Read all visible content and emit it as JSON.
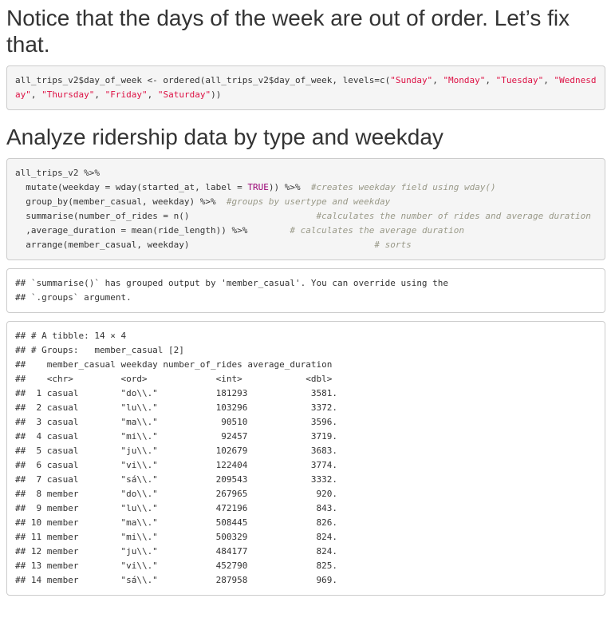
{
  "heading1": "Notice that the days of the week are out of order. Let’s fix that.",
  "code1": {
    "prefix": "all_trips_v2$day_of_week <- ordered(all_trips_v2$day_of_week, levels=c(",
    "levels": [
      "\"Sunday\"",
      "\"Monday\"",
      "\"Tuesday\"",
      "\"Wednesday\"",
      "\"Thursday\"",
      "\"Friday\"",
      "\"Saturday\""
    ],
    "suffix": "))"
  },
  "heading2": "Analyze ridership data by type and weekday",
  "code2": {
    "line1": "all_trips_v2 %>%",
    "line2_code_a": "  mutate(weekday = wday(started_at, label = ",
    "line2_true": "TRUE",
    "line2_code_b": ")) %>%  ",
    "line2_comment": "#creates weekday field using wday()",
    "line3_code": "  group_by(member_casual, weekday) %>%  ",
    "line3_comment": "#groups by usertype and weekday",
    "line4_code": "  summarise(number_of_rides = n()                        ",
    "line4_comment": "#calculates the number of rides and average duration",
    "line5_code": "  ,average_duration = mean(ride_length)) %>%        ",
    "line5_comment": "# calculates the average duration",
    "line6_code": "  arrange(member_casual, weekday)                                   ",
    "line6_comment": "# sorts"
  },
  "message": {
    "line1": "## `summarise()` has grouped output by 'member_casual'. You can override using the",
    "line2": "## `.groups` argument."
  },
  "tibble": {
    "header_lines": [
      "## # A tibble: 14 × 4",
      "## # Groups:   member_casual [2]",
      "##    member_casual weekday number_of_rides average_duration",
      "##    <chr>         <ord>             <int>            <dbl>"
    ],
    "rows": [
      "##  1 casual        \"do\\\\.\"           181293            3581.",
      "##  2 casual        \"lu\\\\.\"           103296            3372.",
      "##  3 casual        \"ma\\\\.\"            90510            3596.",
      "##  4 casual        \"mi\\\\.\"            92457            3719.",
      "##  5 casual        \"ju\\\\.\"           102679            3683.",
      "##  6 casual        \"vi\\\\.\"           122404            3774.",
      "##  7 casual        \"sá\\\\.\"           209543            3332.",
      "##  8 member        \"do\\\\.\"           267965             920.",
      "##  9 member        \"lu\\\\.\"           472196             843.",
      "## 10 member        \"ma\\\\.\"           508445             826.",
      "## 11 member        \"mi\\\\.\"           500329             824.",
      "## 12 member        \"ju\\\\.\"           484177             824.",
      "## 13 member        \"vi\\\\.\"           452790             825.",
      "## 14 member        \"sá\\\\.\"           287958             969."
    ]
  },
  "colors": {
    "string": "#dd1144",
    "keyword": "#990073",
    "comment": "#999988",
    "text": "#333333",
    "code_bg": "#f5f5f5",
    "border": "#cccccc"
  }
}
